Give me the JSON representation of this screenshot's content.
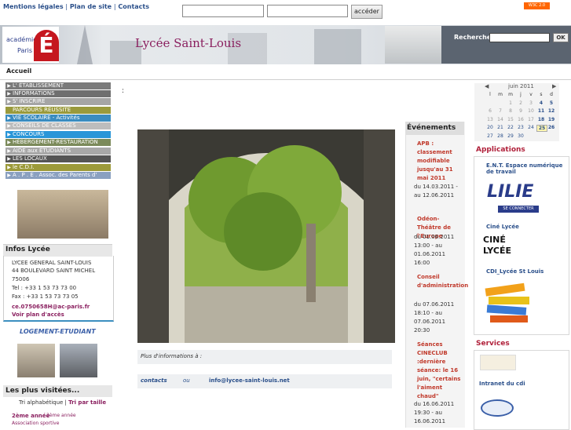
{
  "top": {
    "links": [
      "Mentions légales",
      "Plan de site",
      "Contacts"
    ],
    "search_button": "accéder",
    "w3c_badge": "W3C 2.0"
  },
  "banner": {
    "academie_line1": "académie",
    "academie_line2": "Paris",
    "academie_letter": "É",
    "title": "Lycée Saint-Louis",
    "search_label": "Recherche",
    "search_ok": "OK"
  },
  "breadcrumb": "Accueil",
  "menu": [
    {
      "label": "L' ÉTABLISSEMENT",
      "color": "#7a7a7a"
    },
    {
      "label": "INFORMATIONS",
      "color": "#6f6f6f"
    },
    {
      "label": "S' INSCRIRE",
      "color": "#a5a5a5"
    },
    {
      "label": "PARCOURS RÉUSSITE",
      "color": "#9a9a3c"
    },
    {
      "label": "VIE SCOLAIRE - Activités",
      "color": "#3a8cc0"
    },
    {
      "label": "CONSEILS DE CLASSES",
      "color": "#bdbdbd"
    },
    {
      "label": "CONCOURS",
      "color": "#2a96d8"
    },
    {
      "label": "HÉBERGEMENT-RESTAURATION",
      "color": "#7b8a5a"
    },
    {
      "label": "AIDE aux ÉTUDIANTS",
      "color": "#a8a8a8"
    },
    {
      "label": "LES LOCAUX",
      "color": "#555555"
    },
    {
      "label": "le C.D.I.",
      "color": "#9c9a3a"
    },
    {
      "label": "A . P . E .  Assoc. des Parents d' élèves",
      "color": "#8aa0c0"
    }
  ],
  "infos": {
    "title": "Infos Lycée",
    "lines": [
      "LYCEE GENERAL SAINT-LOUIS",
      "44 BOULEVARD SAINT MICHEL",
      "75006",
      "Tel : +33 1 53 73 73 00",
      "Fax : +33 1 53 73 73 05"
    ],
    "email": "ce.0750658H@ac-paris.fr",
    "plan_link": "Voir plan d'accès"
  },
  "logement": "LOGEMENT-ETUDIANT",
  "visitees": {
    "title": "Les plus visitées...",
    "tri_alpha": "Tri alphabétique",
    "tri_taille": "Tri par taille",
    "item1": "2ème année",
    "item1b": "3ème année",
    "item2": "Association sportive"
  },
  "main": {
    "colon": ":",
    "plus_infos": "Plus d'informations à :",
    "contacts": "contacts",
    "ou": "ou",
    "mail": "info@lycee-saint-louis.net"
  },
  "events": {
    "title": "Événements",
    "items": [
      {
        "title": "APB : classement modifiable jusqu'au 31 mai 2011",
        "date": "du 14.03.2011 - au 12.06.2011"
      },
      {
        "title": "Odéon-Théâtre de l'Europe",
        "date": "du 01.06.2011 13:00 - au 01.06.2011 16:00"
      },
      {
        "title": "Conseil d'administration",
        "date": "du 07.06.2011 18:10 - au 07.06.2011 20:30"
      },
      {
        "title": "Séances CINECLUB :dernière séance: le 16 juin, \"certains l'aiment chaud\"",
        "date": "du 16.06.2011 19:30 - au 16.06.2011"
      }
    ]
  },
  "calendar": {
    "month": "juin 2011",
    "days": [
      "l",
      "m",
      "m",
      "j",
      "v",
      "s",
      "d"
    ],
    "weeks": [
      [
        "",
        "",
        "1",
        "2",
        "3",
        "4",
        "5"
      ],
      [
        "6",
        "7",
        "8",
        "9",
        "10",
        "11",
        "12"
      ],
      [
        "13",
        "14",
        "15",
        "16",
        "17",
        "18",
        "19"
      ],
      [
        "20",
        "21",
        "22",
        "23",
        "24",
        "25",
        "26"
      ],
      [
        "27",
        "28",
        "29",
        "30",
        "",
        "",
        ""
      ]
    ]
  },
  "applications": {
    "title": "Applications",
    "ent": "E.N.T. Espace numérique de travail",
    "lilie": "LILIE",
    "lilie_sub": "SE CONNECTER",
    "cine": "Ciné Lycée",
    "cine_logo1": "CINÉ",
    "cine_logo2": "LYCÉE",
    "cdi": "CDI_Lycée St Louis"
  },
  "services": {
    "title": "Services",
    "intranet": "Intranet du cdi"
  }
}
